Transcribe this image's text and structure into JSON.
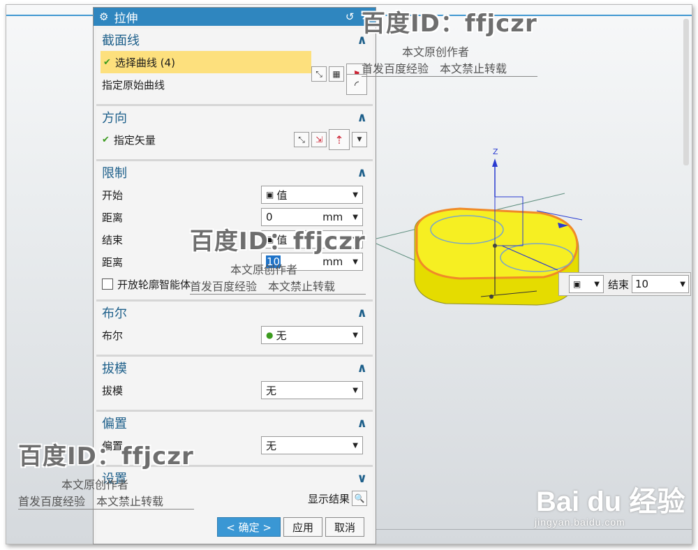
{
  "dialog": {
    "title": "拉伸",
    "sections": {
      "section_curve": {
        "title": "截面线",
        "select_curve": "选择曲线 (4)",
        "specify_original": "指定原始曲线"
      },
      "direction": {
        "title": "方向",
        "specify_vector": "指定矢量"
      },
      "limits": {
        "title": "限制",
        "start_label": "开始",
        "start_value": "值",
        "distance1_label": "距离",
        "distance1_value": "0",
        "distance1_unit": "mm",
        "end_label": "结束",
        "end_value": "值",
        "distance2_label": "距离",
        "distance2_value": "10",
        "distance2_unit": "mm",
        "open_profile": "开放轮廓智能体"
      },
      "boolean": {
        "title": "布尔",
        "label": "布尔",
        "value": "无"
      },
      "draft": {
        "title": "拔模",
        "label": "拔模",
        "value": "无"
      },
      "offset": {
        "title": "偏置",
        "label": "偏置",
        "value": "无"
      },
      "settings": {
        "title": "设置"
      }
    },
    "footer": {
      "show_result": "显示结果",
      "ok": "< 确定 >",
      "apply": "应用",
      "cancel": "取消"
    }
  },
  "viewport": {
    "axis_label": "Z",
    "float_end_label": "结束",
    "float_end_value": "10"
  },
  "watermarks": {
    "id_text": "百度ID：ffjczr",
    "original_author": "本文原创作者",
    "first_publish": "首发百度经验　本文禁止转载",
    "logo": "Bai du 经验",
    "url": "jingyan.baidu.com"
  },
  "colors": {
    "title_bar": "#2f86bf",
    "section_title": "#1d5f8a",
    "selected_row": "#fde07d",
    "solid_fill": "#f1e900",
    "solid_edge": "#f08a28"
  }
}
